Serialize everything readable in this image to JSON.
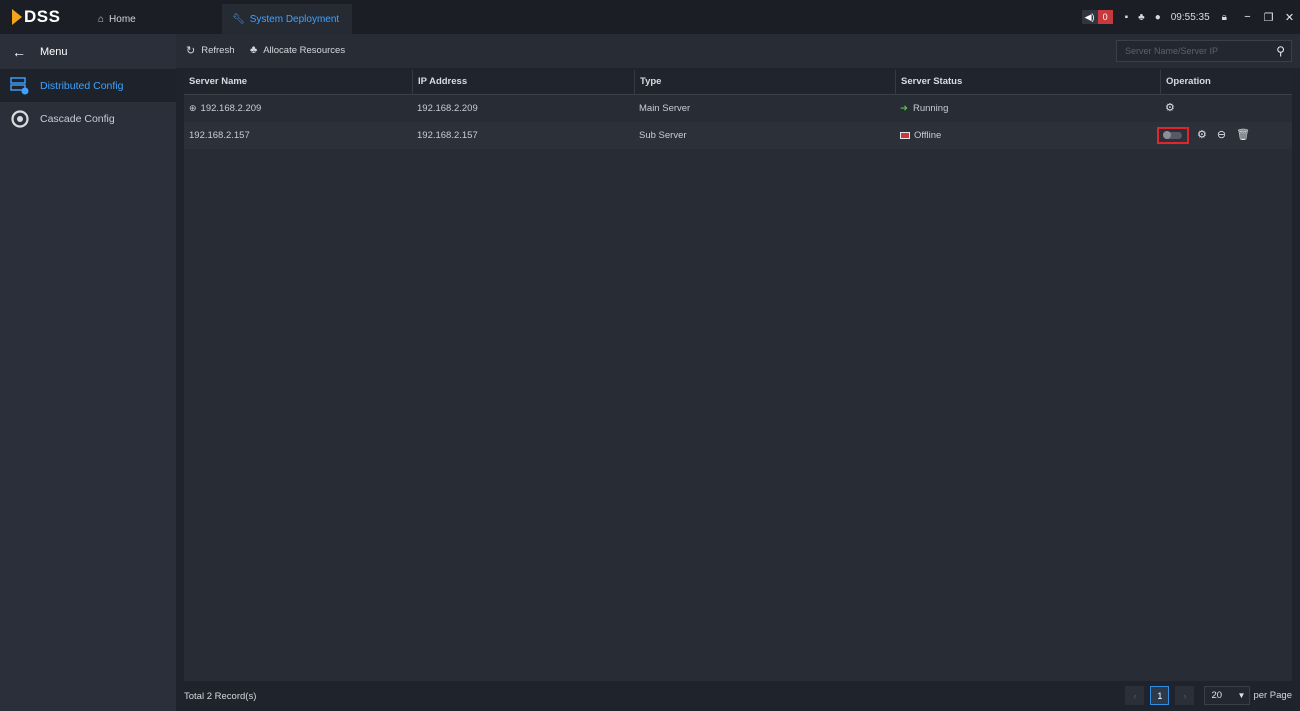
{
  "app": {
    "logo_text": "DSS"
  },
  "tabs": [
    {
      "label": "Home",
      "icon": "home-icon"
    },
    {
      "label": "System Deployment",
      "icon": "wrench-icon"
    }
  ],
  "tray": {
    "alarm_count": "0",
    "clock": "09:55:35"
  },
  "sidebar": {
    "menu_label": "Menu",
    "items": [
      {
        "label": "Distributed Config",
        "icon": "distributed-config-icon",
        "active": true
      },
      {
        "label": "Cascade Config",
        "icon": "cascade-config-icon",
        "active": false
      }
    ]
  },
  "toolbar": {
    "refresh_label": "Refresh",
    "allocate_label": "Allocate Resources",
    "search_placeholder": "Server Name/Server IP"
  },
  "table": {
    "columns": [
      "Server Name",
      "IP Address",
      "Type",
      "Server Status",
      "Operation"
    ],
    "rows": [
      {
        "name": "192.168.2.209",
        "ip": "192.168.2.209",
        "type": "Main Server",
        "status": "Running"
      },
      {
        "name": "192.168.2.157",
        "ip": "192.168.2.157",
        "type": "Sub Server",
        "status": "Offline"
      }
    ]
  },
  "footer": {
    "total_label": "Total",
    "total_count": "2",
    "records_label": "Record(s)",
    "current_page": "1",
    "page_size": "20",
    "per_page_label": "per Page"
  },
  "colors": {
    "accent": "#3fa3ff",
    "alarm": "#c8393c",
    "highlight": "#e0262d",
    "running": "#4caf50"
  }
}
